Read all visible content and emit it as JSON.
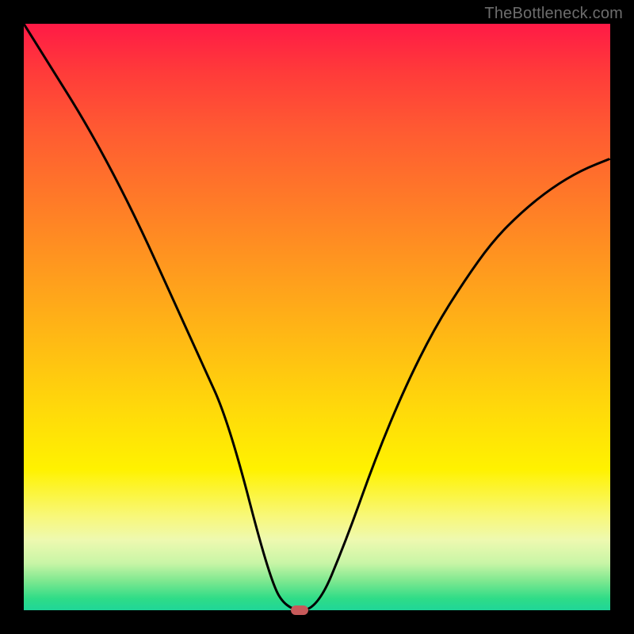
{
  "watermark": "TheBottleneck.com",
  "chart_data": {
    "type": "line",
    "title": "",
    "xlabel": "",
    "ylabel": "",
    "xlim": [
      0,
      100
    ],
    "ylim": [
      0,
      100
    ],
    "grid": false,
    "series": [
      {
        "name": "curve",
        "x": [
          0,
          5,
          10,
          15,
          20,
          25,
          30,
          35,
          42,
          45,
          50,
          55,
          60,
          65,
          70,
          75,
          80,
          85,
          90,
          95,
          100
        ],
        "values": [
          100,
          92,
          84,
          75,
          65,
          54,
          43,
          32,
          5,
          0,
          0,
          12,
          26,
          38,
          48,
          56,
          63,
          68,
          72,
          75,
          77
        ]
      }
    ],
    "marker": {
      "x": 47,
      "y": 0
    },
    "background_gradient": {
      "top": "#ff1a46",
      "middle": "#fff200",
      "bottom": "#1fd698"
    }
  }
}
